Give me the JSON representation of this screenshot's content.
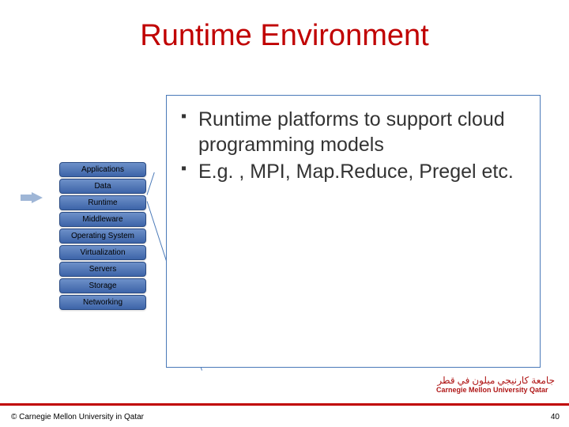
{
  "title": "Runtime Environment",
  "stack": {
    "layers": [
      "Applications",
      "Data",
      "Runtime",
      "Middleware",
      "Operating System",
      "Virtualization",
      "Servers",
      "Storage",
      "Networking"
    ]
  },
  "callout": {
    "bullets": [
      "Runtime platforms to support cloud programming models",
      "E.g. , MPI, Map.Reduce, Pregel etc."
    ]
  },
  "footer": {
    "copyright": "© Carnegie Mellon University in Qatar",
    "pagenum": "40"
  },
  "logo": {
    "line1": "جامعة كارنيجي ميلون في قطر",
    "line2": "Carnegie Mellon University Qatar"
  }
}
